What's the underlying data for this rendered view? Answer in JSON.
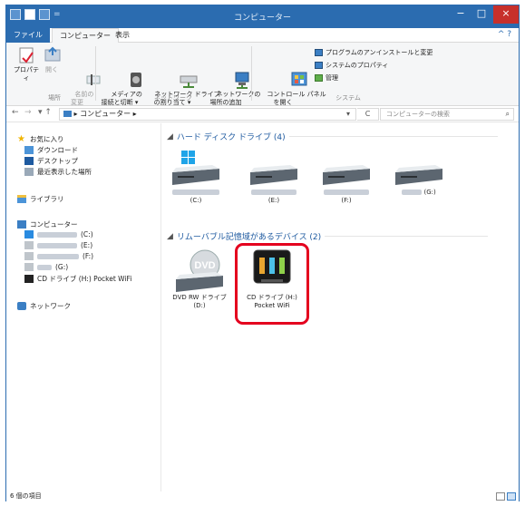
{
  "window": {
    "title": "コンピューター",
    "min_label": "−",
    "max_label": "□",
    "close_label": "×",
    "qa_sep": "="
  },
  "tabs": {
    "file": "ファイル",
    "computer": "コンピューター",
    "view": "表示",
    "help": "^ ?"
  },
  "ribbon": {
    "properties": "プロパティ",
    "open": "開く",
    "rename": "名前の\n変更",
    "media": "メディアの\n接続と切断 ▾",
    "map_drive": "ネットワーク ドライブ\nの割り当て ▾",
    "add_location": "ネットワークの\n場所の追加",
    "control_panel": "コントロール パネル\nを開く",
    "uninstall": "プログラムのアンインストールと変更",
    "sys_props": "システムのプロパティ",
    "manage": "管理",
    "group_location": "場所",
    "group_network": "ネットワーク",
    "group_system": "システム"
  },
  "address": {
    "back": "←",
    "forward": "→",
    "up": "▾ ↑",
    "path": "▸ コンピューター ▸",
    "dropdown": "▾",
    "refresh": "C",
    "search_placeholder": "コンピューターの検索",
    "search_icon": "⌕"
  },
  "navpane": {
    "favorites": "お気に入り",
    "downloads": "ダウンロード",
    "desktop": "デスクトップ",
    "recent": "最近表示した場所",
    "libraries": "ライブラリ",
    "computer": "コンピューター",
    "c_drive": "(C:)",
    "e_drive": "(E:)",
    "f_drive": "(F:)",
    "g_drive": "(G:)",
    "cd_drive": "CD ドライブ (H:) Pocket WiFi",
    "network": "ネットワーク"
  },
  "content": {
    "hdd_section": "ハード ディスク ドライブ (4)",
    "removable_section": "リムーバブル記憶域があるデバイス (2)",
    "drives_hdd": [
      {
        "letter": "(C:)"
      },
      {
        "letter": "(E:)"
      },
      {
        "letter": "(F:)"
      },
      {
        "letter": "(G:)"
      }
    ],
    "dvd_label": "DVD RW ドライブ\n(D:)",
    "dvd_icon_text": "DVD",
    "cd_label": "CD ドライブ (H:)\nPocket WiFi"
  },
  "statusbar": {
    "items": "6 個の項目"
  },
  "colors": {
    "accent": "#2b6cb0",
    "highlight": "#e4001e",
    "close": "#c7302b",
    "windows_logo": "#1fa4e8"
  }
}
